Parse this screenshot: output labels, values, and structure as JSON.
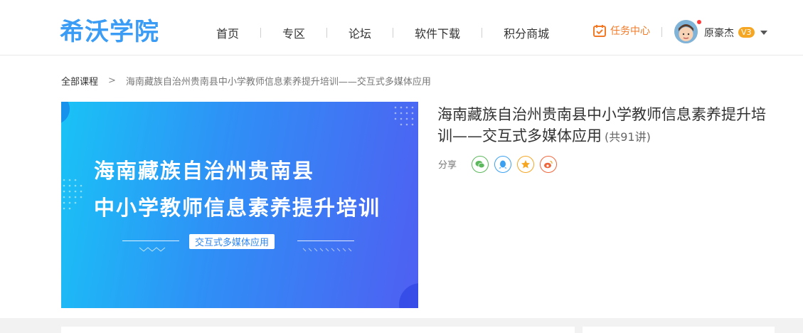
{
  "header": {
    "logo": "希沃学院",
    "nav": [
      {
        "label": "首页"
      },
      {
        "label": "专区"
      },
      {
        "label": "论坛"
      },
      {
        "label": "软件下载"
      },
      {
        "label": "积分商城"
      }
    ],
    "task_center": "任务中心",
    "username": "原豪杰",
    "level": "V3",
    "icons": {
      "task": "calendar-check-icon",
      "caret": "chevron-down-icon"
    }
  },
  "breadcrumb": {
    "home": "全部课程",
    "separator": ">",
    "current": "海南藏族自治州贵南县中小学教师信息素养提升培训——交互式多媒体应用"
  },
  "banner": {
    "line1": "海南藏族自治州贵南县",
    "line2": "中小学教师信息素养提升培训",
    "tag": "交互式多媒体应用"
  },
  "course": {
    "title": "海南藏族自治州贵南县中小学教师信息素养提升培训——交互式多媒体应用",
    "count": "(共91讲)"
  },
  "share": {
    "label": "分享",
    "targets": [
      {
        "icon": "wechat-icon",
        "color": "#5cb85c"
      },
      {
        "icon": "qq-icon",
        "color": "#3aa1f2"
      },
      {
        "icon": "qzone-star-icon",
        "color": "#f5a623"
      },
      {
        "icon": "weibo-icon",
        "color": "#f0663b"
      }
    ]
  },
  "colors": {
    "brand": "#3a9cf5",
    "accent": "#f27a27"
  }
}
